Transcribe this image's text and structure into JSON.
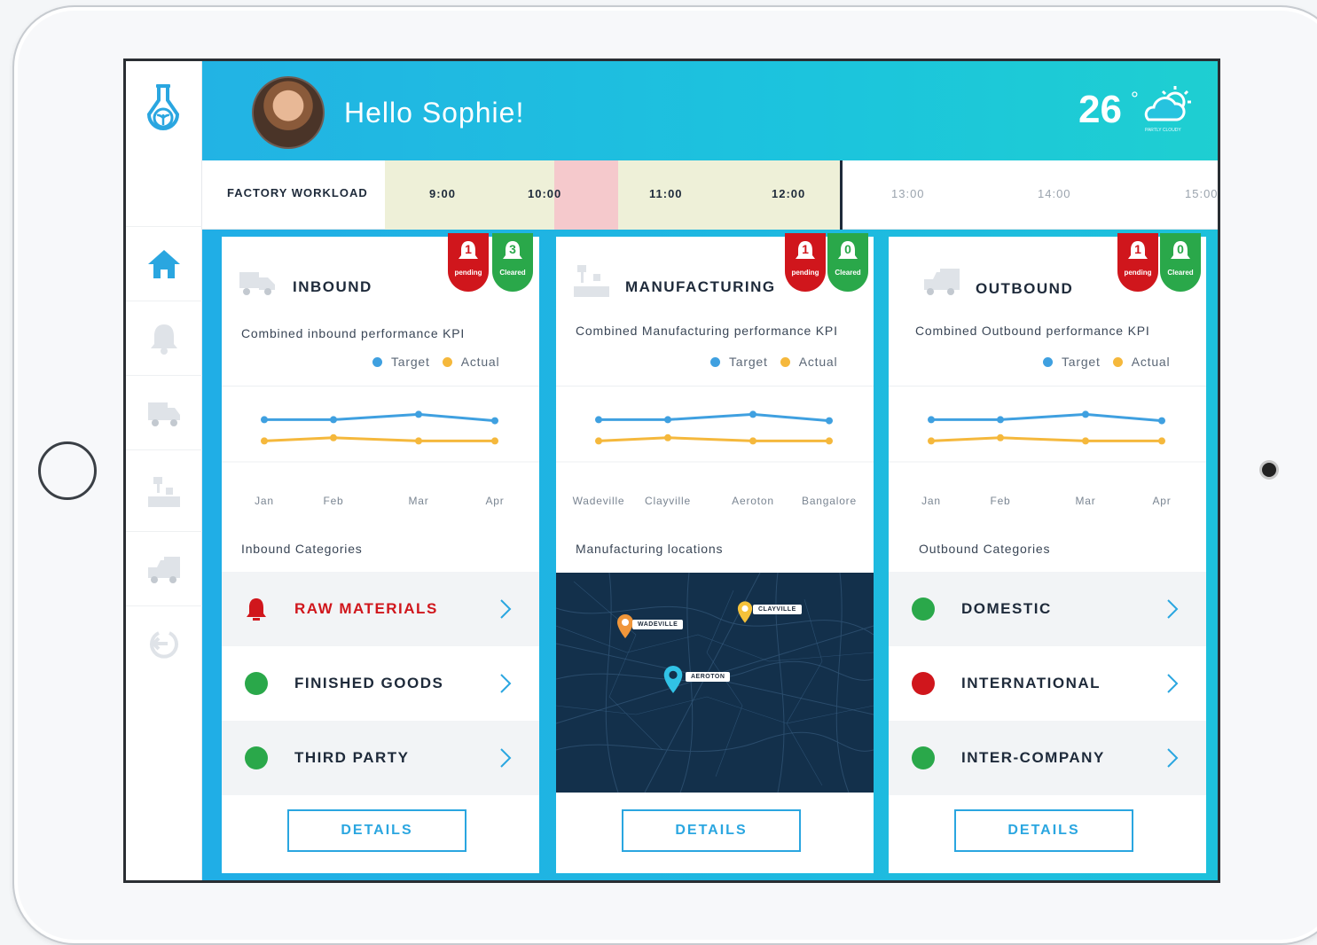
{
  "header": {
    "greeting": "Hello Sophie!",
    "weather": {
      "temperature": "26",
      "degree": "°",
      "condition": "PARTLY CLOUDY"
    }
  },
  "workload": {
    "label": "FACTORY WORKLOAD",
    "times": [
      "9:00",
      "10:00",
      "11:00",
      "12:00",
      "13:00",
      "14:00",
      "15:00"
    ]
  },
  "sidebar": {
    "items": [
      "home-icon",
      "bell-icon",
      "truck-icon",
      "factory-icon",
      "outbound-truck-icon",
      "logout-icon"
    ]
  },
  "colors": {
    "target": "#3fa0e0",
    "actual": "#f5b83c",
    "pending": "#d0161c",
    "cleared": "#2aa84a",
    "accent": "#2aa6e0"
  },
  "cards": [
    {
      "title": "INBOUND",
      "pending_count": "1",
      "pending_label": "pending",
      "cleared_count": "3",
      "cleared_label": "Cleared",
      "kpi_title": "Combined inbound performance KPI",
      "legend": {
        "target": "Target",
        "actual": "Actual"
      },
      "section_label": "Inbound Categories",
      "categories": [
        {
          "label": "RAW MATERIALS",
          "status": "alert"
        },
        {
          "label": "FINISHED GOODS",
          "status": "green"
        },
        {
          "label": "THIRD PARTY",
          "status": "green"
        }
      ],
      "details": "DETAILS"
    },
    {
      "title": "MANUFACTURING",
      "pending_count": "1",
      "pending_label": "pending",
      "cleared_count": "0",
      "cleared_label": "Cleared",
      "kpi_title": "Combined Manufacturing performance KPI",
      "legend": {
        "target": "Target",
        "actual": "Actual"
      },
      "section_label": "Manufacturing locations",
      "map": {
        "pins": [
          "WADEVILLE",
          "CLAYVILLE",
          "AEROTON"
        ]
      },
      "details": "DETAILS"
    },
    {
      "title": "OUTBOUND",
      "pending_count": "1",
      "pending_label": "pending",
      "cleared_count": "0",
      "cleared_label": "Cleared",
      "kpi_title": "Combined Outbound performance KPI",
      "legend": {
        "target": "Target",
        "actual": "Actual"
      },
      "section_label": "Outbound Categories",
      "categories": [
        {
          "label": "DOMESTIC",
          "status": "green"
        },
        {
          "label": "INTERNATIONAL",
          "status": "red"
        },
        {
          "label": "INTER-COMPANY",
          "status": "green"
        }
      ],
      "details": "DETAILS"
    }
  ],
  "chart_data": [
    {
      "type": "line",
      "categories": [
        "Jan",
        "Feb",
        "Mar",
        "Apr"
      ],
      "series": [
        {
          "name": "Target",
          "values": [
            6.8,
            6.8,
            7.3,
            6.7
          ]
        },
        {
          "name": "Actual",
          "values": [
            4.8,
            5.1,
            4.8,
            4.8
          ]
        }
      ]
    },
    {
      "type": "line",
      "categories": [
        "Wadeville",
        "Clayville",
        "Aeroton",
        "Bangalore"
      ],
      "series": [
        {
          "name": "Target",
          "values": [
            6.8,
            6.8,
            7.3,
            6.7
          ]
        },
        {
          "name": "Actual",
          "values": [
            4.8,
            5.1,
            4.8,
            4.8
          ]
        }
      ]
    },
    {
      "type": "line",
      "categories": [
        "Jan",
        "Feb",
        "Mar",
        "Apr"
      ],
      "series": [
        {
          "name": "Target",
          "values": [
            6.8,
            6.8,
            7.3,
            6.7
          ]
        },
        {
          "name": "Actual",
          "values": [
            4.8,
            5.1,
            4.8,
            4.8
          ]
        }
      ]
    }
  ]
}
